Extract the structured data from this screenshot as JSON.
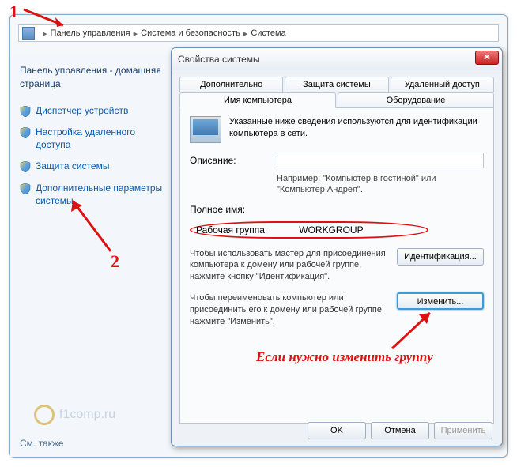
{
  "breadcrumb": {
    "items": [
      "Панель управления",
      "Система и безопасность",
      "Система"
    ]
  },
  "leftPanel": {
    "home": "Панель управления - домашняя страница",
    "links": [
      "Диспетчер устройств",
      "Настройка удаленного доступа",
      "Защита системы",
      "Дополнительные параметры системы"
    ],
    "seeAlso": "См. также"
  },
  "watermark": "f1comp.ru",
  "dialog": {
    "title": "Свойства системы",
    "tabsRow1": [
      "Дополнительно",
      "Защита системы",
      "Удаленный доступ"
    ],
    "tabsRow2": [
      "Имя компьютера",
      "Оборудование"
    ],
    "desc": "Указанные ниже сведения используются для идентификации компьютера в сети.",
    "descLabel": "Описание:",
    "descValue": "",
    "example": "Например: \"Компьютер в гостиной\" или \"Компьютер Андрея\".",
    "fullNameLabel": "Полное имя:",
    "fullNameValue": "",
    "wgLabel": "Рабочая группа:",
    "wgValue": "WORKGROUP",
    "para1": "Чтобы использовать мастер для присоединения компьютера к домену или рабочей группе, нажмите кнопку \"Идентификация\".",
    "btnIdentify": "Идентификация...",
    "para2": "Чтобы переименовать компьютер или присоединить его к домену или рабочей группе, нажмите \"Изменить\".",
    "btnChange": "Изменить...",
    "btnOk": "OK",
    "btnCancel": "Отмена",
    "btnApply": "Применить"
  },
  "annotations": {
    "n1": "1",
    "n2": "2",
    "text": "Если нужно изменить группу"
  }
}
